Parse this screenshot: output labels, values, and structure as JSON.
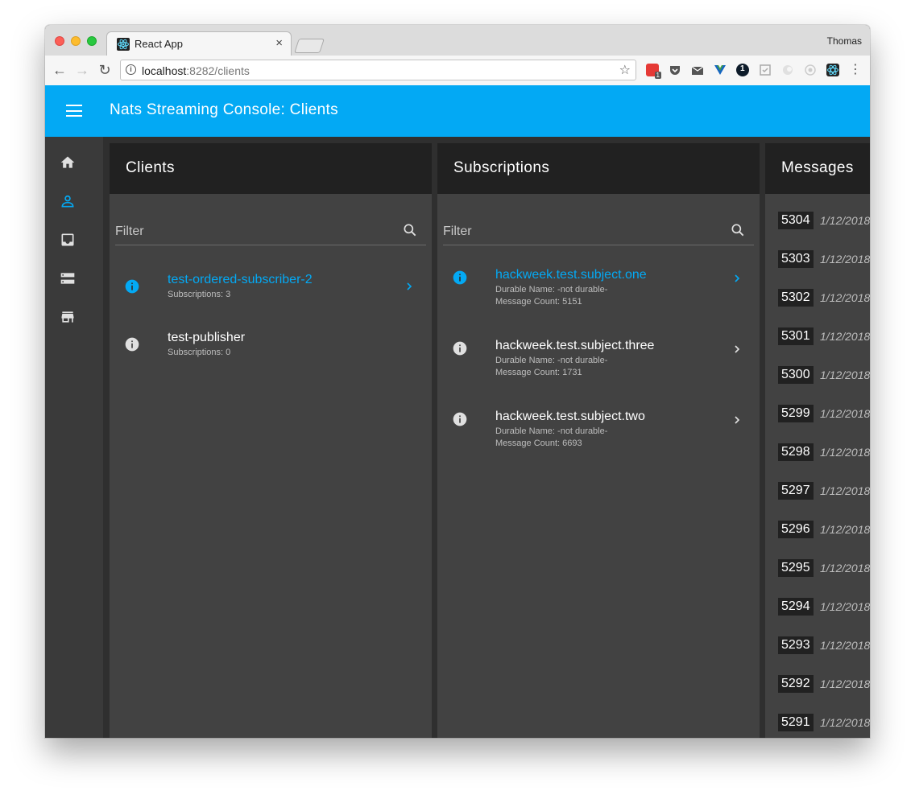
{
  "browser": {
    "tab_title": "React App",
    "tab_close": "×",
    "profile_name": "Thomas",
    "url_host": "localhost",
    "url_rest": ":8282/clients",
    "back_glyph": "←",
    "forward_glyph": "→",
    "reload_glyph": "↻",
    "star_glyph": "☆",
    "menu_glyph": "⋮",
    "extension_badge": "1"
  },
  "appbar": {
    "title": "Nats Streaming Console: Clients",
    "color": "#03a9f4"
  },
  "sidenav": {
    "items": [
      {
        "name": "home-icon",
        "active": false
      },
      {
        "name": "person-icon",
        "active": true
      },
      {
        "name": "inbox-icon",
        "active": false
      },
      {
        "name": "server-icon",
        "active": false
      },
      {
        "name": "store-icon",
        "active": false
      }
    ]
  },
  "clients": {
    "title": "Clients",
    "filter_label": "Filter",
    "items": [
      {
        "name": "test-ordered-subscriber-2",
        "subscriptions": "Subscriptions: 3",
        "active": true
      },
      {
        "name": "test-publisher",
        "subscriptions": "Subscriptions: 0",
        "active": false
      }
    ]
  },
  "subscriptions": {
    "title": "Subscriptions",
    "filter_label": "Filter",
    "items": [
      {
        "subject": "hackweek.test.subject.one",
        "durable": "Durable Name: -not durable-",
        "count": "Message Count: 5151",
        "active": true
      },
      {
        "subject": "hackweek.test.subject.three",
        "durable": "Durable Name: -not durable-",
        "count": "Message Count: 1731",
        "active": false
      },
      {
        "subject": "hackweek.test.subject.two",
        "durable": "Durable Name: -not durable-",
        "count": "Message Count: 6693",
        "active": false
      }
    ]
  },
  "messages": {
    "title": "Messages",
    "items": [
      {
        "id": "5304",
        "date": "1/12/2018"
      },
      {
        "id": "5303",
        "date": "1/12/2018"
      },
      {
        "id": "5302",
        "date": "1/12/2018"
      },
      {
        "id": "5301",
        "date": "1/12/2018"
      },
      {
        "id": "5300",
        "date": "1/12/2018"
      },
      {
        "id": "5299",
        "date": "1/12/2018"
      },
      {
        "id": "5298",
        "date": "1/12/2018"
      },
      {
        "id": "5297",
        "date": "1/12/2018"
      },
      {
        "id": "5296",
        "date": "1/12/2018"
      },
      {
        "id": "5295",
        "date": "1/12/2018"
      },
      {
        "id": "5294",
        "date": "1/12/2018"
      },
      {
        "id": "5293",
        "date": "1/12/2018"
      },
      {
        "id": "5292",
        "date": "1/12/2018"
      },
      {
        "id": "5291",
        "date": "1/12/2018"
      }
    ]
  },
  "colors": {
    "accent": "#03a9f4",
    "panel": "#424242",
    "panel_header": "#212121",
    "sidenav": "#3a3a3a"
  }
}
